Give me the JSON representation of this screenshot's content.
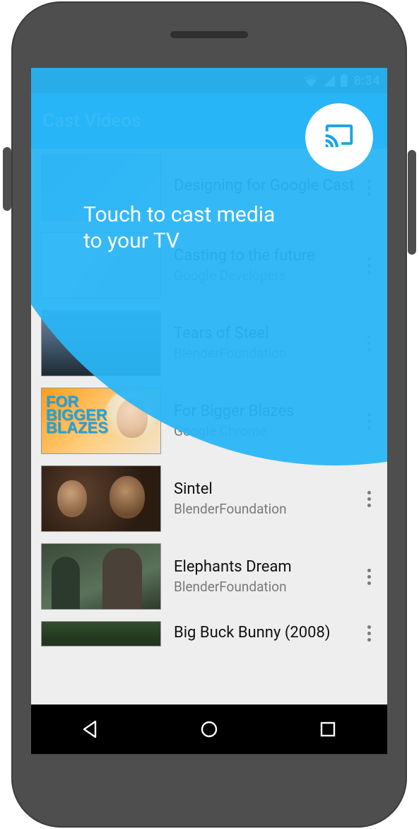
{
  "status": {
    "time": "8:34"
  },
  "appbar": {
    "title": "Cast Videos"
  },
  "overlay": {
    "line1": "Touch to cast media",
    "line2": "to your TV"
  },
  "thumb3_text": "FOR\nBIGGER\nBLAZES",
  "videos": [
    {
      "title": "Designing for Google Cast",
      "subtitle": ""
    },
    {
      "title": "Casting to the future",
      "subtitle": "Google Developers"
    },
    {
      "title": "Tears of Steel",
      "subtitle": "BlenderFoundation"
    },
    {
      "title": "For Bigger Blazes",
      "subtitle": "Google Chrome"
    },
    {
      "title": "Sintel",
      "subtitle": "BlenderFoundation"
    },
    {
      "title": "Elephants Dream",
      "subtitle": "BlenderFoundation"
    },
    {
      "title": "Big Buck Bunny (2008)",
      "subtitle": ""
    }
  ],
  "colors": {
    "accent": "#29b6f6",
    "appbar": "#03a9f4"
  }
}
